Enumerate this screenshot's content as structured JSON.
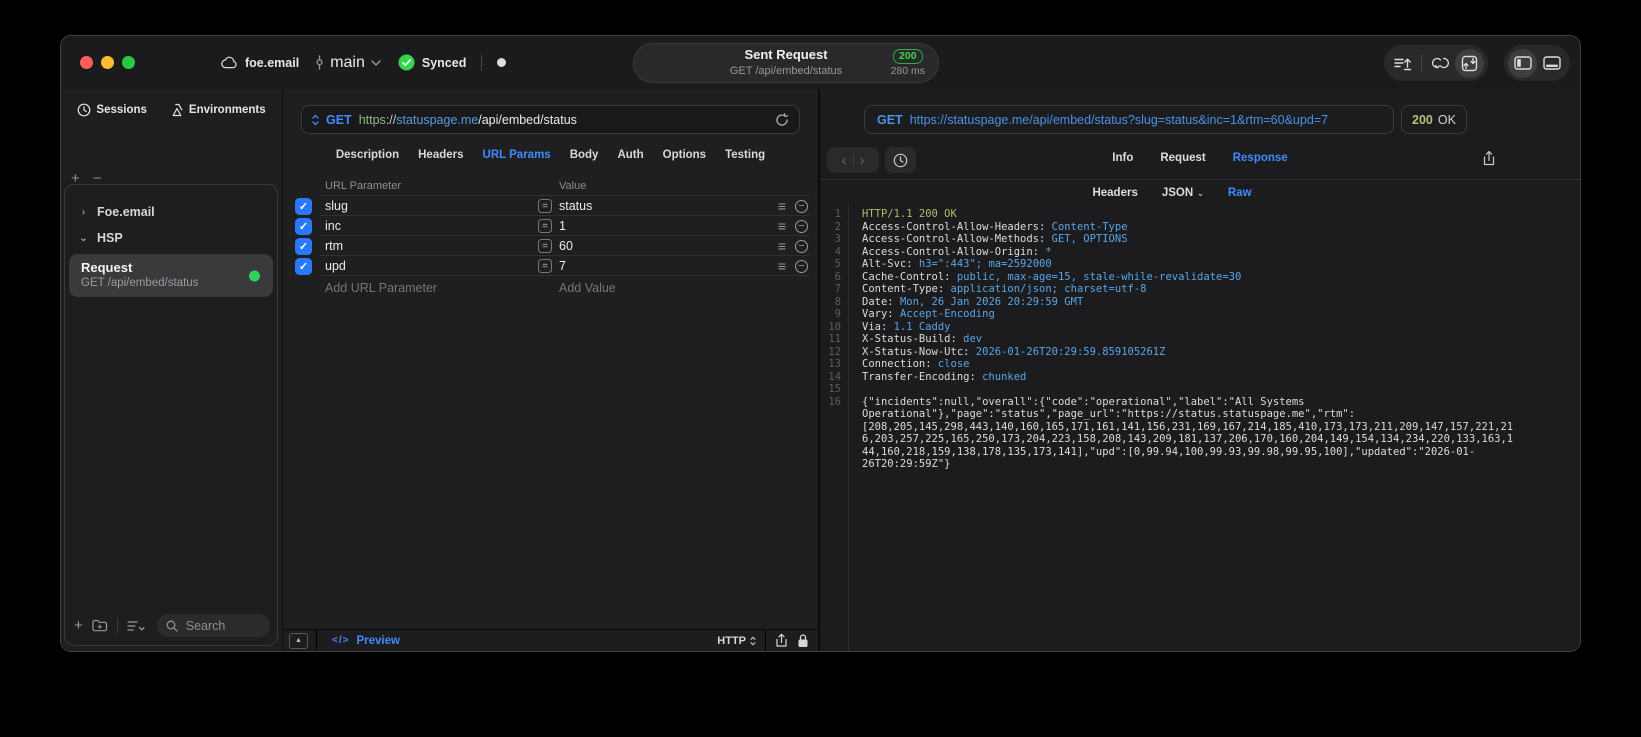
{
  "titlebar": {
    "project": "foe.email",
    "branch": "main",
    "sync_label": "Synced",
    "request_summary": {
      "title": "Sent Request",
      "subtitle": "GET /api/embed/status",
      "status_code": "200",
      "duration": "280 ms"
    }
  },
  "sidebar": {
    "tabs": [
      {
        "label": "Sessions",
        "icon": "clock-icon"
      },
      {
        "label": "Environments",
        "icon": "environments-icon"
      }
    ],
    "tree": [
      {
        "label": "Foe.email",
        "state": "collapsed"
      },
      {
        "label": "HSP",
        "state": "expanded"
      }
    ],
    "request_item": {
      "title": "Request",
      "method_path": "GET /api/embed/status",
      "indicator_color": "#30d158"
    },
    "search": {
      "placeholder": "Search"
    }
  },
  "request_editor": {
    "method": "GET",
    "url": {
      "scheme": "https",
      "separator": "://",
      "host": "statuspage.me",
      "path": "/api/embed/status"
    },
    "tabs": [
      "Description",
      "Headers",
      "URL Params",
      "Body",
      "Auth",
      "Options",
      "Testing"
    ],
    "active_tab": "URL Params",
    "params_table": {
      "columns": [
        "URL Parameter",
        "Value"
      ],
      "rows": [
        {
          "enabled": true,
          "name": "slug",
          "value": "status"
        },
        {
          "enabled": true,
          "name": "inc",
          "value": "1"
        },
        {
          "enabled": true,
          "name": "rtm",
          "value": "60"
        },
        {
          "enabled": true,
          "name": "upd",
          "value": "7"
        }
      ],
      "add_parameter_placeholder": "Add URL Parameter",
      "add_value_placeholder": "Add Value"
    },
    "footer": {
      "preview_label": "Preview",
      "protocol": "HTTP"
    }
  },
  "response_viewer": {
    "request_line": {
      "method": "GET",
      "url": "https://statuspage.me/api/embed/status?slug=status&inc=1&rtm=60&upd=7"
    },
    "status": {
      "code": "200",
      "text": "OK"
    },
    "tabs": [
      "Info",
      "Request",
      "Response"
    ],
    "active_tab": "Response",
    "view_tabs": [
      "Headers",
      "JSON",
      "Raw"
    ],
    "active_view_tab": "Raw",
    "body_lines": [
      {
        "num": "1",
        "segments": [
          {
            "text": "HTTP/1.1 200 OK",
            "style": "green"
          }
        ]
      },
      {
        "num": "2",
        "segments": [
          {
            "text": "Access-Control-Allow-Headers: ",
            "style": "plain"
          },
          {
            "text": "Content-Type",
            "style": "blue"
          }
        ]
      },
      {
        "num": "3",
        "segments": [
          {
            "text": "Access-Control-Allow-Methods: ",
            "style": "plain"
          },
          {
            "text": "GET, OPTIONS",
            "style": "blue"
          }
        ]
      },
      {
        "num": "4",
        "segments": [
          {
            "text": "Access-Control-Allow-Origin: ",
            "style": "plain"
          },
          {
            "text": "*",
            "style": "blue"
          }
        ]
      },
      {
        "num": "5",
        "segments": [
          {
            "text": "Alt-Svc: ",
            "style": "plain"
          },
          {
            "text": "h3=\":443\"; ma=2592000",
            "style": "blue"
          }
        ]
      },
      {
        "num": "6",
        "segments": [
          {
            "text": "Cache-Control: ",
            "style": "plain"
          },
          {
            "text": "public, max-age=15, stale-while-revalidate=30",
            "style": "blue"
          }
        ]
      },
      {
        "num": "7",
        "segments": [
          {
            "text": "Content-Type: ",
            "style": "plain"
          },
          {
            "text": "application/json; charset=utf-8",
            "style": "blue"
          }
        ]
      },
      {
        "num": "8",
        "segments": [
          {
            "text": "Date: ",
            "style": "plain"
          },
          {
            "text": "Mon, 26 Jan 2026 20:29:59 GMT",
            "style": "blue"
          }
        ]
      },
      {
        "num": "9",
        "segments": [
          {
            "text": "Vary: ",
            "style": "plain"
          },
          {
            "text": "Accept-Encoding",
            "style": "blue"
          }
        ]
      },
      {
        "num": "10",
        "segments": [
          {
            "text": "Via: ",
            "style": "plain"
          },
          {
            "text": "1.1 Caddy",
            "style": "blue"
          }
        ]
      },
      {
        "num": "11",
        "segments": [
          {
            "text": "X-Status-Build: ",
            "style": "plain"
          },
          {
            "text": "dev",
            "style": "blue"
          }
        ]
      },
      {
        "num": "12",
        "segments": [
          {
            "text": "X-Status-Now-Utc: ",
            "style": "plain"
          },
          {
            "text": "2026-01-26T20:29:59.859105261Z",
            "style": "blue"
          }
        ]
      },
      {
        "num": "13",
        "segments": [
          {
            "text": "Connection: ",
            "style": "plain"
          },
          {
            "text": "close",
            "style": "blue"
          }
        ]
      },
      {
        "num": "14",
        "segments": [
          {
            "text": "Transfer-Encoding: ",
            "style": "plain"
          },
          {
            "text": "chunked",
            "style": "blue"
          }
        ]
      },
      {
        "num": "15",
        "segments": []
      },
      {
        "num": "16",
        "segments": [
          {
            "text": "{\"incidents\":null,\"overall\":{\"code\":\"operational\",\"label\":\"All Systems Operational\"},\"page\":\"status\",\"page_url\":\"https://status.statuspage.me\",\"rtm\":[208,205,145,298,443,140,160,165,171,161,141,156,231,169,167,214,185,410,173,173,211,209,147,157,221,216,203,257,225,165,250,173,204,223,158,208,143,209,181,137,206,170,160,204,149,154,134,234,220,133,163,144,160,218,159,138,178,135,173,141],\"upd\":[0,99.94,100,99.93,99.98,99.95,100],\"updated\":\"2026-01-26T20:29:59Z\"}",
            "style": "plain"
          }
        ]
      }
    ]
  },
  "colors": {
    "accent_blue": "#3f8cff",
    "success_green": "#32d74b",
    "status_code_green": "#b5c075",
    "syntax_value_blue": "#58a6e8",
    "syntax_status_green": "#a3c168",
    "checkbox_blue": "#2979ff",
    "traffic_red": "#ff5f57",
    "traffic_yellow": "#febc2e",
    "traffic_green": "#28c840"
  }
}
